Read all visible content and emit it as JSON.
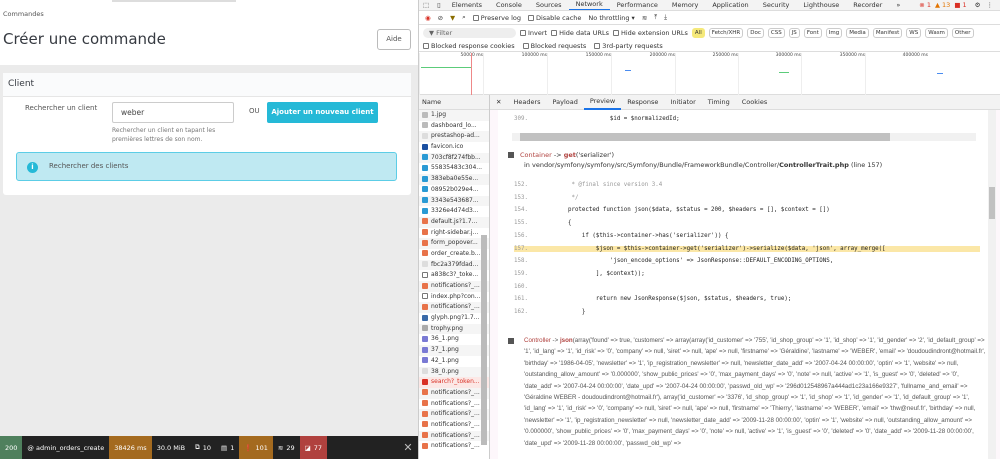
{
  "page": {
    "breadcrumb": "Commandes",
    "title": "Créer une commande",
    "help_button": "Aide",
    "client_card": {
      "title": "Client",
      "search_label": "Rechercher un client",
      "search_value": "weber",
      "search_help": "Rechercher un client en tapant les premières lettres de son nom.",
      "or": "OU",
      "add_button": "Ajouter un nouveau client",
      "info": "Rechercher des clients"
    }
  },
  "debug_bar": {
    "status": "200",
    "route": "@ admin_orders_create",
    "time": "38426 ms",
    "memory": "30.0 MiB",
    "forms": "10",
    "translations": "1",
    "logs": "101",
    "queries": "29",
    "errors": "77"
  },
  "devtools": {
    "tabs": [
      "Elements",
      "Console",
      "Sources",
      "Network",
      "Performance",
      "Memory",
      "Application",
      "Security",
      "Lighthouse",
      "Recorder",
      "»"
    ],
    "active_tab": "Network",
    "counts": {
      "errors": "1",
      "warnings": "13",
      "issues": "1"
    },
    "toolbar": {
      "preserve_log": "Preserve log",
      "disable_cache": "Disable cache",
      "throttling": "No throttling"
    },
    "filter": {
      "placeholder": "Filter",
      "invert": "Invert",
      "hide_data_urls": "Hide data URLs",
      "hide_ext": "Hide extension URLs",
      "types": [
        "All",
        "Fetch/XHR",
        "Doc",
        "CSS",
        "JS",
        "Font",
        "Img",
        "Media",
        "Manifest",
        "WS",
        "Wasm",
        "Other"
      ]
    },
    "blocked": [
      "Blocked response cookies",
      "Blocked requests",
      "3rd-party requests"
    ],
    "timeline_ticks": [
      "50000 ms",
      "100000 ms",
      "150000 ms",
      "200000 ms",
      "250000 ms",
      "300000 ms",
      "350000 ms",
      "400000 ms"
    ],
    "name_header": "Name",
    "files": [
      "1.jpg",
      "dashboard_lo...",
      "prestashop-ad...",
      "favicon.ico",
      "703cf8f274fbb...",
      "55835483c304...",
      "383eba0e55e...",
      "08952b029e4...",
      "3343e543687...",
      "3326e4d74d3...",
      "default.js?1.7...",
      "right-sidebar.j...",
      "form_popover...",
      "order_create.b...",
      "fbc2a379fdad...",
      "a838c3?_toke...",
      "notifications?_...",
      "index.php?con...",
      "notifications?_...",
      "glyph.png?1.7...",
      "trophy.png",
      "36_1.png",
      "37_1.png",
      "42_1.png",
      "38_0.png",
      "search?_token...",
      "notifications?_...",
      "notifications?_...",
      "notifications?_...",
      "notifications?_...",
      "notifications?_...",
      "notifications?_..."
    ],
    "preview_tabs": [
      "Headers",
      "Payload",
      "Preview",
      "Response",
      "Initiator",
      "Timing",
      "Cookies"
    ],
    "active_preview_tab": "Preview",
    "trace": {
      "prev_line": {
        "n": "309.",
        "code": "                $id = $normalizedId;"
      },
      "frame1": {
        "class": "Container",
        "call": "get",
        "args": "('serializer')",
        "in": "in vendor/symfony/symfony/src/Symfony/Bundle/FrameworkBundle/Controller/",
        "file": "ControllerTrait.php",
        "line": "(line 157)"
      },
      "code": [
        {
          "n": "152.",
          "code": "     * @final since version 3.4"
        },
        {
          "n": "153.",
          "code": "     */"
        },
        {
          "n": "154.",
          "code": "    protected function json($data, $status = 200, $headers = [], $context = [])"
        },
        {
          "n": "155.",
          "code": "    {"
        },
        {
          "n": "156.",
          "code": "        if ($this->container->has('serializer')) {"
        },
        {
          "n": "157.",
          "code": "            $json = $this->container->get('serializer')->serialize($data, 'json', array_merge(["
        },
        {
          "n": "158.",
          "code": "                'json_encode_options' => JsonResponse::DEFAULT_ENCODING_OPTIONS,"
        },
        {
          "n": "159.",
          "code": "            ], $context));"
        },
        {
          "n": "160.",
          "code": ""
        },
        {
          "n": "161.",
          "code": "            return new JsonResponse($json, $status, $headers, true);"
        },
        {
          "n": "162.",
          "code": "        }"
        }
      ],
      "frame2": {
        "class": "Controller",
        "call": "json",
        "args": "(array('found' => true, 'customers' => array(array('id_customer' => '755', 'id_shop_group' => '1', 'id_shop' => '1', 'id_gender' => '2', 'id_default_group' => '1', 'id_lang' => '1', 'id_risk' => '0', 'company' => null, 'siret' => null, 'ape' => null, 'firstname' => 'Géraldine', 'lastname' => 'WEBER', 'email' => 'doudoudindront@hotmail.fr', 'birthday' => '1986-04-05', 'newsletter' => '1', 'ip_registration_newsletter' => null, 'newsletter_date_add' => '2007-04-24 00:00:00', 'optin' => '1', 'website' => null, 'outstanding_allow_amount' => '0.000000', 'show_public_prices' => '0', 'max_payment_days' => '0', 'note' => null, 'active' => '1', 'is_guest' => '0', 'deleted' => '0', 'date_add' => '2007-04-24 00:00:00', 'date_upd' => '2007-04-24 00:00:00', 'passwd_old_wp' => '296d012548967a444ad1c23a166e9327', 'fullname_and_email' => 'Géraldine WEBER - doudoudindront@hotmail.fr'), array('id_customer' => '3376', 'id_shop_group' => '1', 'id_shop' => '1', 'id_gender' => '1', 'id_default_group' => '1', 'id_lang' => '1', 'id_risk' => '0', 'company' => null, 'siret' => null, 'ape' => null, 'firstname' => 'Thierry', 'lastname' => 'WEBER', 'email' => 'thw@neuf.fr', 'birthday' => null, 'newsletter' => '1', 'ip_registration_newsletter' => null, 'newsletter_date_add' => '2009-11-28 00:00:00', 'optin' => '1', 'website' => null, 'outstanding_allow_amount' => '0.000000', 'show_public_prices' => '0', 'max_payment_days' => '0', 'note' => null, 'active' => '1', 'is_guest' => '0', 'deleted' => '0', 'date_add' => '2009-11-28 00:00:00', 'date_upd' => '2009-11-28 00:00:00', 'passwd_old_wp' =>"
      }
    }
  }
}
